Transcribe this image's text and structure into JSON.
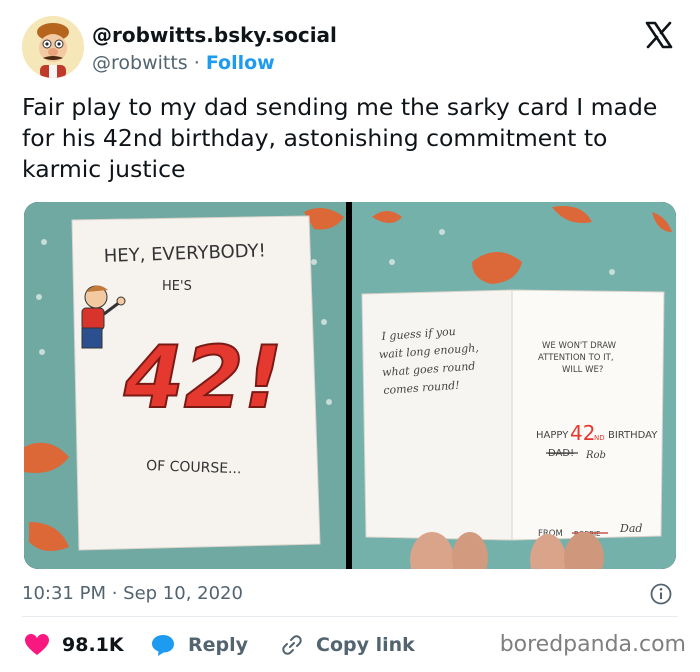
{
  "author": {
    "display_name": "@robwitts.bsky.social",
    "handle": "@robwitts",
    "separator": " · ",
    "follow_label": "Follow",
    "avatar_icon": "cartoon-avatar"
  },
  "brand_icon": "x-logo",
  "tweet": {
    "text": "Fair play to my dad sending me the sarky card I made for his 42nd birthday, astonishing commitment to karmic justice"
  },
  "media": {
    "card_front": {
      "line1": "HEY, EVERYBODY!",
      "line2": "HE'S",
      "number": "42!",
      "line3": "OF COURSE..."
    },
    "card_inside": {
      "left_lines": [
        "I guess if you",
        "wait long enough,",
        "what goes round",
        "comes round!"
      ],
      "right_lines": [
        "WE WON'T DRAW",
        "ATTENTION TO IT,",
        "WILL WE?"
      ],
      "happy_prefix": "HAPPY",
      "happy_number": "42",
      "happy_suffix": "ND",
      "happy_birthday": "BIRTHDAY",
      "struck_name": "DAD!",
      "replacement_name": "Rob",
      "from_label": "FROM",
      "struck_from": "ROBBIE",
      "replacement_from": "Dad"
    }
  },
  "meta": {
    "time": "10:31 PM",
    "separator": " · ",
    "date": "Sep 10, 2020"
  },
  "actions": {
    "like_count": "98.1K",
    "reply_label": "Reply",
    "copy_label": "Copy link",
    "like_color": "#f91880",
    "reply_color": "#1d9bf0"
  },
  "watermark": "boredpanda.com"
}
